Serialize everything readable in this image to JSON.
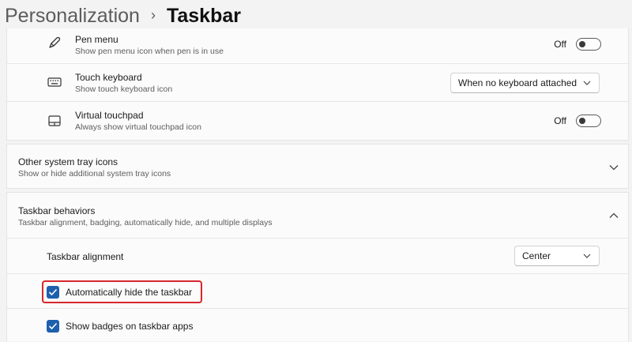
{
  "breadcrumb": {
    "parent": "Personalization",
    "separator": "›",
    "current": "Taskbar"
  },
  "tray_items": [
    {
      "title": "Pen menu",
      "subtitle": "Show pen menu icon when pen is in use",
      "icon": "pen-icon",
      "control": "toggle",
      "state": "Off"
    },
    {
      "title": "Touch keyboard",
      "subtitle": "Show touch keyboard icon",
      "icon": "keyboard-icon",
      "control": "dropdown",
      "value": "When no keyboard attached"
    },
    {
      "title": "Virtual touchpad",
      "subtitle": "Always show virtual touchpad icon",
      "icon": "touchpad-icon",
      "control": "toggle",
      "state": "Off"
    }
  ],
  "other_tray": {
    "title": "Other system tray icons",
    "subtitle": "Show or hide additional system tray icons",
    "expanded": false
  },
  "behaviors": {
    "title": "Taskbar behaviors",
    "subtitle": "Taskbar alignment, badging, automatically hide, and multiple displays",
    "expanded": true,
    "alignment_label": "Taskbar alignment",
    "alignment_value": "Center",
    "auto_hide_label": "Automatically hide the taskbar",
    "auto_hide_checked": true,
    "badges_label": "Show badges on taskbar apps",
    "badges_checked": true
  },
  "colors": {
    "accent": "#1e5fae",
    "highlight": "#d7272c"
  }
}
